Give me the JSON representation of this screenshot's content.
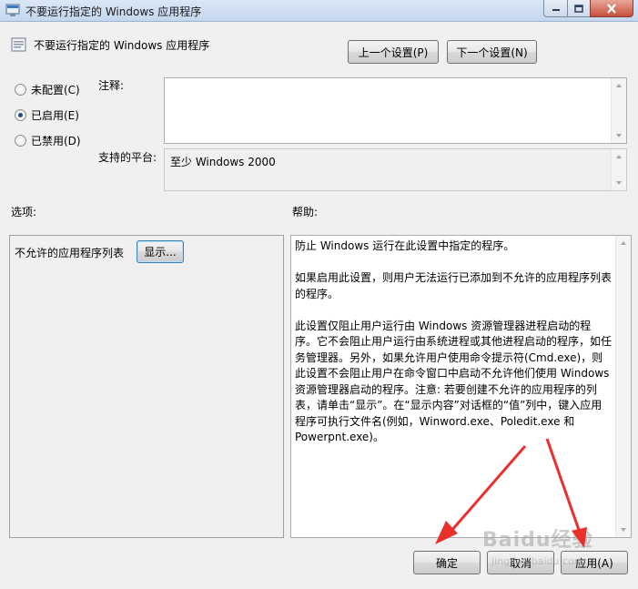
{
  "window": {
    "title": "不要运行指定的 Windows 应用程序"
  },
  "header": {
    "policy_title": "不要运行指定的 Windows 应用程序",
    "prev_setting": "上一个设置(P)",
    "next_setting": "下一个设置(N)"
  },
  "state": {
    "options": [
      {
        "label": "未配置(C)",
        "checked": false
      },
      {
        "label": "已启用(E)",
        "checked": true
      },
      {
        "label": "已禁用(D)",
        "checked": false
      }
    ]
  },
  "comment": {
    "label": "注释:",
    "value": ""
  },
  "platform": {
    "label": "支持的平台:",
    "value": "至少 Windows 2000"
  },
  "options_panel": {
    "label": "选项:",
    "list_label": "不允许的应用程序列表",
    "show_button": "显示..."
  },
  "help_panel": {
    "label": "帮助:",
    "text": "防止 Windows 运行在此设置中指定的程序。\n\n如果启用此设置，则用户无法运行已添加到不允许的应用程序列表的程序。\n\n此设置仅阻止用户运行由 Windows 资源管理器进程启动的程序。它不会阻止用户运行由系统进程或其他进程启动的程序，如任务管理器。另外，如果允许用户使用命令提示符(Cmd.exe)，则此设置不会阻止用户在命令窗口中启动不允许他们使用 Windows 资源管理器启动的程序。注意: 若要创建不允许的应用程序的列表，请单击“显示”。在“显示内容”对话框的“值”列中，键入应用程序可执行文件名(例如，Winword.exe、Poledit.exe 和 Powerpnt.exe)。"
  },
  "footer": {
    "ok": "确定",
    "cancel": "取消",
    "apply": "应用(A)"
  },
  "watermark": {
    "brand": "Baidu经验",
    "url": "jingyan.baidu.com"
  },
  "colors": {
    "annotation_arrow": "#e8312c",
    "titlebar": "#c4d6ee"
  }
}
